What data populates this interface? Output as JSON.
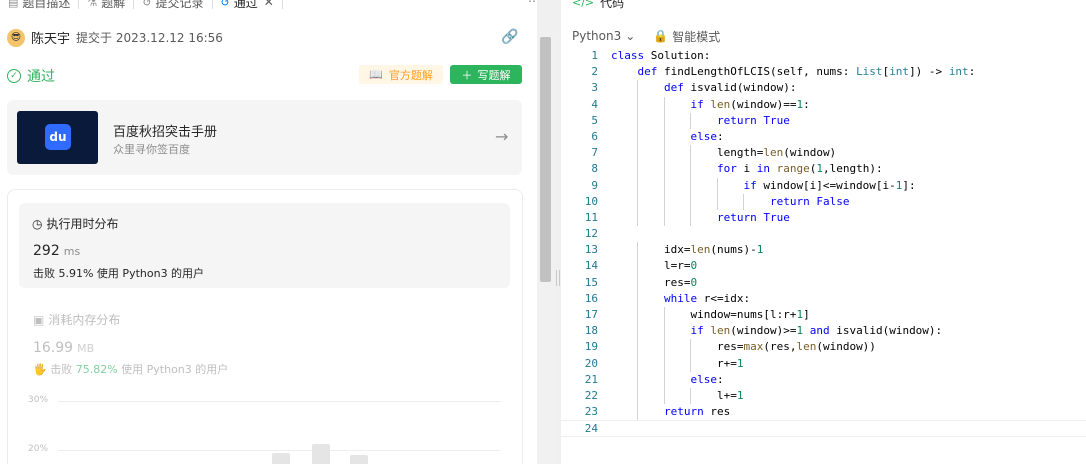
{
  "tabs": [
    {
      "label": "题目描述",
      "icon": "document-icon"
    },
    {
      "label": "题解",
      "icon": "flask-icon"
    },
    {
      "label": "提交记录",
      "icon": "history-icon"
    },
    {
      "label": "通过",
      "icon": "history-icon",
      "active": true
    }
  ],
  "submission": {
    "author": "陈天宇",
    "submitted_at": "提交于 2023.12.12 16:56",
    "status": "通过",
    "official_solution_label": "官方题解",
    "write_solution_label": "写题解"
  },
  "banner": {
    "title": "百度秋招突击手册",
    "subtitle": "众里寻你签百度",
    "logo_text": "du"
  },
  "runtime": {
    "heading": "执行用时分布",
    "value": "292",
    "unit": "ms",
    "beat_text": "击败 5.91% 使用 Python3 的用户"
  },
  "memory": {
    "heading": "消耗内存分布",
    "value": "16.99",
    "unit": "MB",
    "beat_prefix": "击败",
    "beat_pct": "75.82%",
    "beat_suffix": "使用 Python3 的用户"
  },
  "chart_data": {
    "type": "bar",
    "y_ticks": [
      "30%",
      "20%"
    ],
    "ylim": [
      0,
      30
    ]
  },
  "editor": {
    "title": "代码",
    "language": "Python3",
    "mode": "智能模式",
    "lines": [
      "class Solution:",
      "    def findLengthOfLCIS(self, nums: List[int]) -> int:",
      "        def isvalid(window):",
      "            if len(window)==1:",
      "                return True",
      "            else:",
      "                length=len(window)",
      "                for i in range(1,length):",
      "                    if window[i]<=window[i-1]:",
      "                        return False",
      "                return True",
      "",
      "        idx=len(nums)-1",
      "        l=r=0",
      "        res=0",
      "        while r<=idx:",
      "            window=nums[l:r+1]",
      "            if len(window)>=1 and isvalid(window):",
      "                res=max(res,len(window))",
      "                r+=1",
      "            else:",
      "                l+=1",
      "        return res",
      ""
    ]
  },
  "colors": {
    "success": "#2db55d",
    "accent_orange": "#ff9f1a",
    "link_blue": "#007aff"
  }
}
